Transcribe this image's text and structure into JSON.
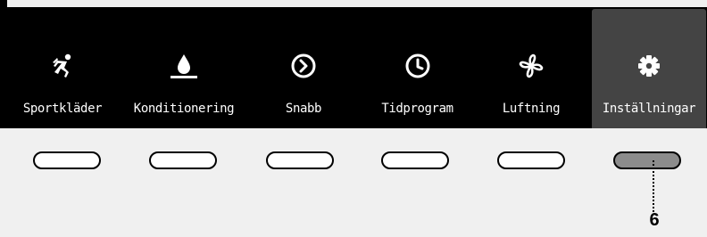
{
  "tabs": [
    {
      "label": "Sportkläder",
      "icon": "running-person-icon"
    },
    {
      "label": "Konditionering",
      "icon": "flame-drop-icon"
    },
    {
      "label": "Snabb",
      "icon": "circle-arrow-right-icon"
    },
    {
      "label": "Tidprogram",
      "icon": "clock-icon"
    },
    {
      "label": "Luftning",
      "icon": "fan-icon"
    },
    {
      "label": "Inställningar",
      "icon": "gear-icon"
    }
  ],
  "selected_tab": "Inställningar",
  "callout": {
    "number": "6"
  },
  "colors": {
    "panel": "#000000",
    "selected_tab": "#444444",
    "active_button": "#8c8c8c",
    "background": "#f0f0f0"
  }
}
